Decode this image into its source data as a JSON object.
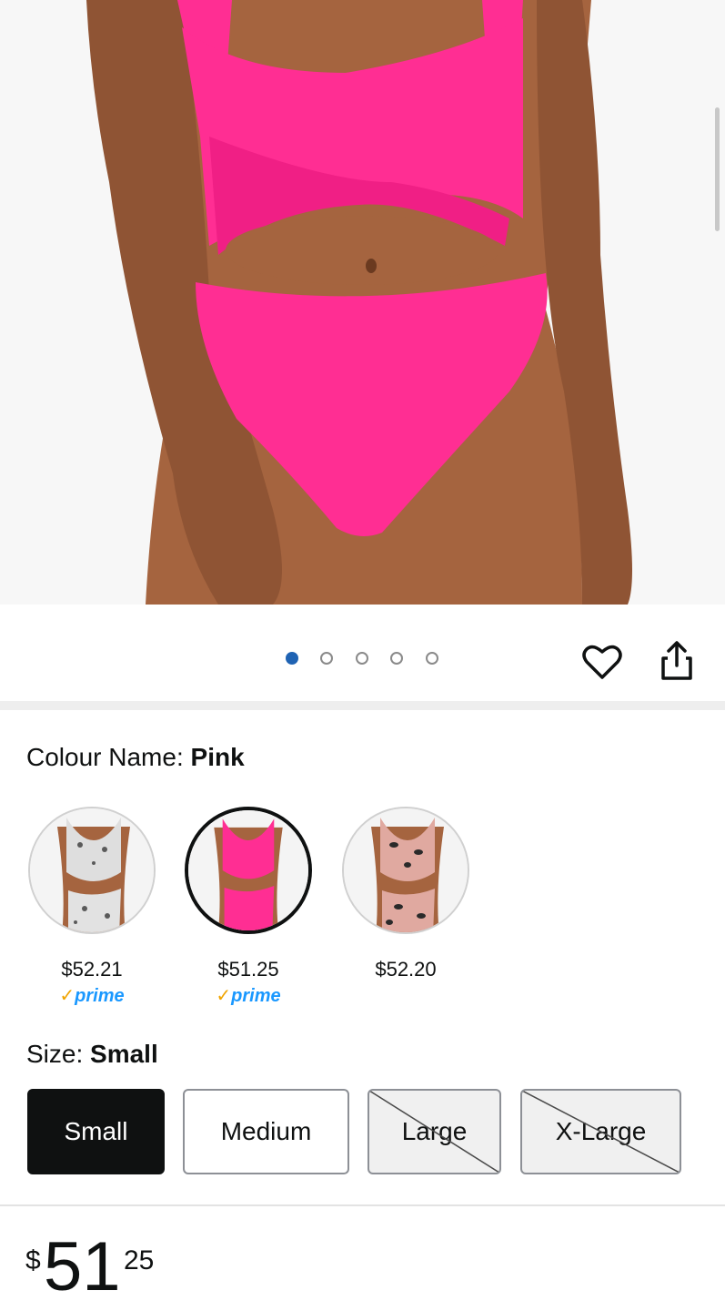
{
  "product": {
    "image_label": "Pink cross-front cutout one-piece swimsuit",
    "image_count": 5,
    "active_image_index": 0
  },
  "colour": {
    "label": "Colour Name: ",
    "value": "Pink",
    "swatches": [
      {
        "name": "snake",
        "price": "$52.21",
        "prime": true
      },
      {
        "name": "pink",
        "price": "$51.25",
        "prime": true,
        "selected": true
      },
      {
        "name": "leopard",
        "price": "$52.20",
        "prime": false
      }
    ]
  },
  "prime_badge": {
    "check": "✓",
    "text": "prime"
  },
  "size": {
    "label": "Size: ",
    "value": "Small",
    "options": [
      {
        "label": "Small",
        "state": "selected"
      },
      {
        "label": "Medium",
        "state": "available"
      },
      {
        "label": "Large",
        "state": "unavailable"
      },
      {
        "label": "X-Large",
        "state": "unavailable"
      }
    ]
  },
  "price": {
    "currency": "$",
    "whole": "51",
    "fraction": "25"
  },
  "colors": {
    "accent_dot": "#1f63b3",
    "prime_blue": "#1a98ff",
    "prime_check": "#f0a400",
    "swimsuit_pink": "#ff2e93"
  },
  "icons": {
    "wishlist": "heart-icon",
    "share": "share-icon"
  }
}
